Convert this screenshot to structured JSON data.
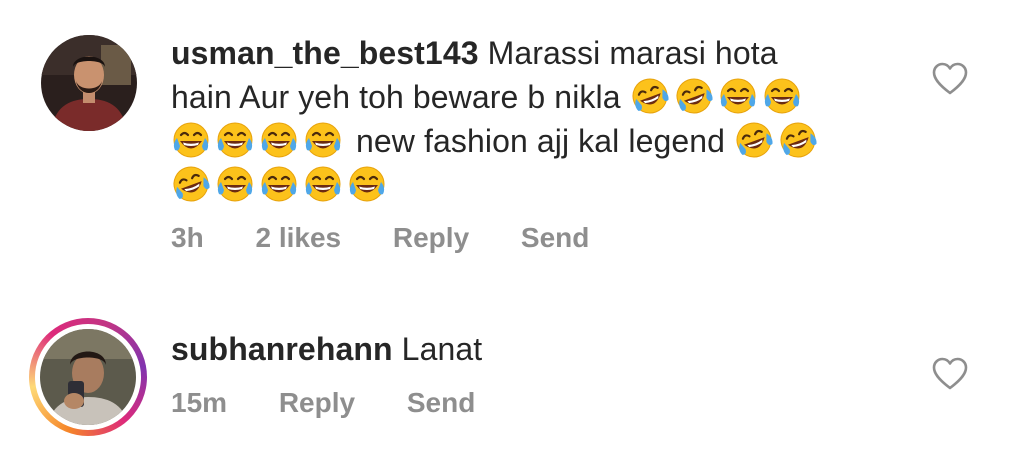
{
  "comments": [
    {
      "username": "usman_the_best143",
      "lines": [
        {
          "text": "Marassi marasi hota"
        },
        {
          "text": "hain Aur yeh toh beware b nikla",
          "emojis_after": [
            "rofl",
            "rofl",
            "joy",
            "joy"
          ]
        },
        {
          "emojis_before": [
            "joy",
            "joy",
            "joy",
            "joy"
          ],
          "text": "new fashion ajj kal legend",
          "emojis_after": [
            "rofl",
            "rofl"
          ]
        },
        {
          "emojis_before": [
            "rofl",
            "joy",
            "joy",
            "joy",
            "joy"
          ]
        }
      ],
      "time": "3h",
      "likes": "2 likes",
      "reply_label": "Reply",
      "send_label": "Send",
      "has_story_ring": false
    },
    {
      "username": "subhanrehann",
      "lines": [
        {
          "text": "Lanat"
        }
      ],
      "time": "15m",
      "reply_label": "Reply",
      "send_label": "Send",
      "has_story_ring": true
    }
  ],
  "icons": {
    "like": "heart-outline-icon",
    "emoji_joy": "face-with-tears-of-joy-icon",
    "emoji_rofl": "rolling-on-the-floor-laughing-icon"
  },
  "colors": {
    "text": "#262626",
    "meta": "#8e8e8e",
    "heart": "#8e8e8e"
  }
}
